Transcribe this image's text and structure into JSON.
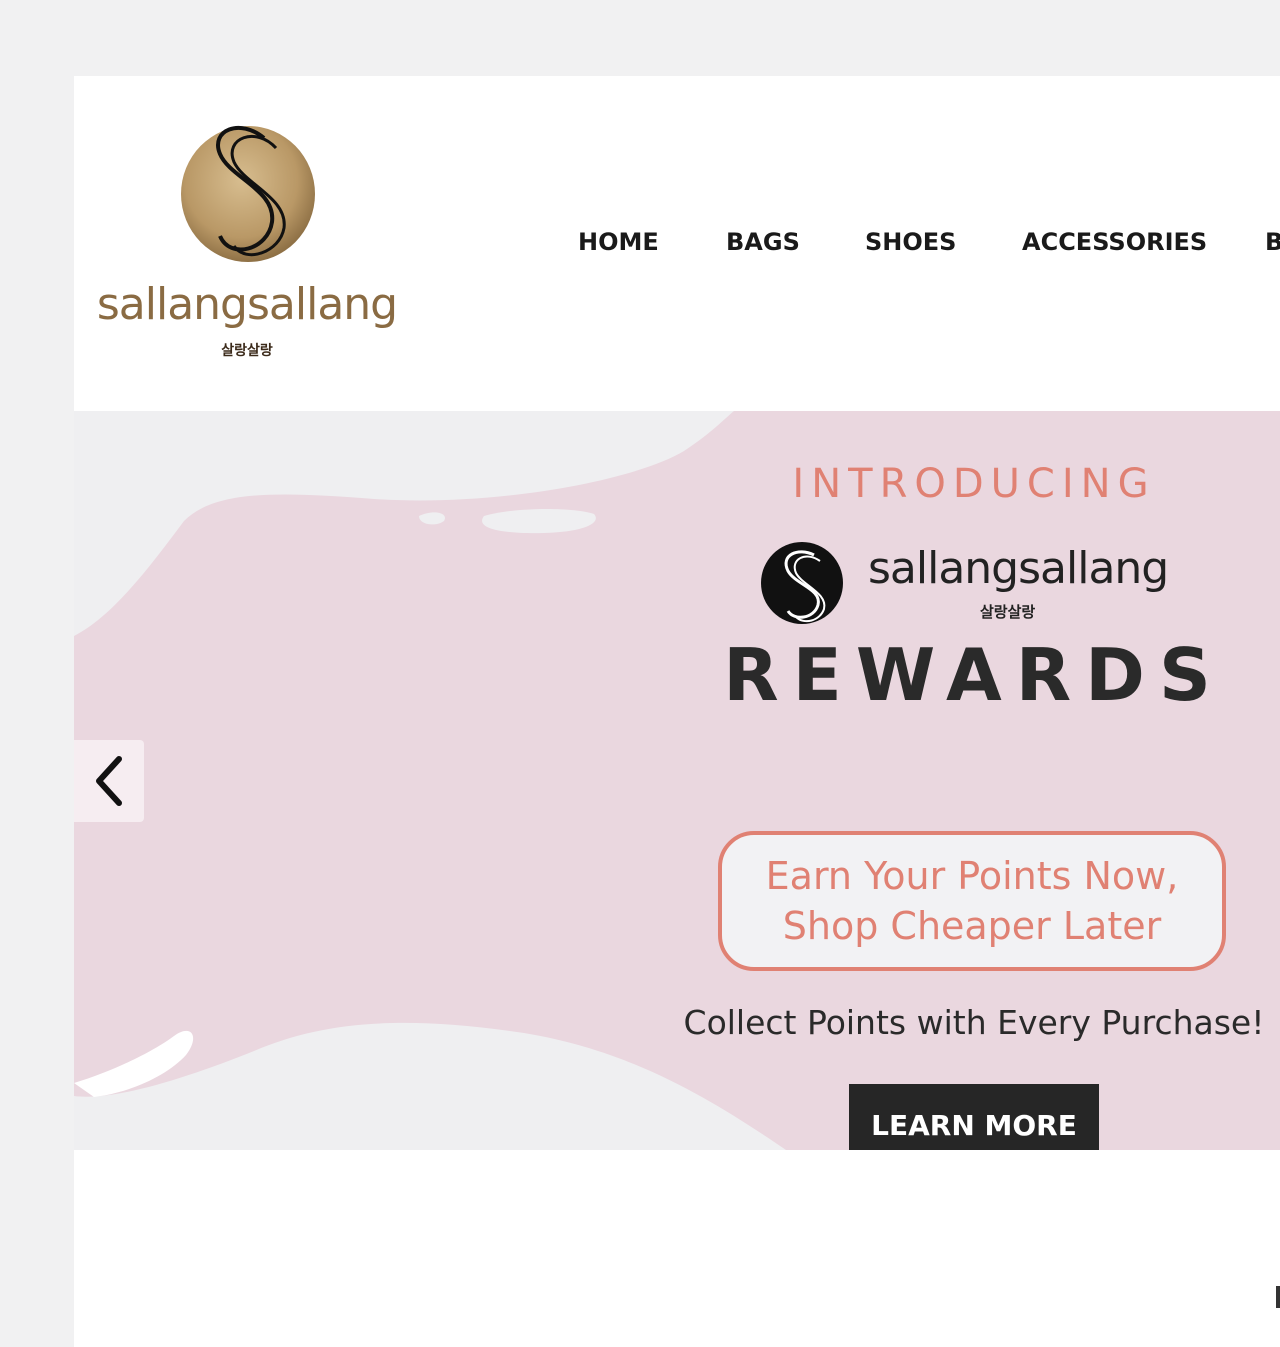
{
  "header": {
    "logo": {
      "wordmark": "sallangsallang",
      "korean": "살랑살랑"
    },
    "nav": {
      "items": [
        {
          "label": "HOME"
        },
        {
          "label": "BAGS"
        },
        {
          "label": "SHOES"
        },
        {
          "label": "ACCESSORIES"
        },
        {
          "label": "B"
        }
      ]
    }
  },
  "hero": {
    "intro": "INTRODUCING",
    "brand_name": "sallangsallang",
    "brand_korean": "살랑살랑",
    "title": "REWARDS",
    "pill_line1": "Earn Your Points Now,",
    "pill_line2": "Shop Cheaper Later",
    "subtitle": "Collect Points with Every Purchase!",
    "cta_label": "LEARN MORE",
    "prev_icon": "chevron-left-icon"
  },
  "colors": {
    "accent_coral": "#e08173",
    "hero_pink": "#ead7df",
    "hero_grey": "#efeff1",
    "cta_dark": "#262626",
    "logo_gold": "#8a6b43"
  }
}
